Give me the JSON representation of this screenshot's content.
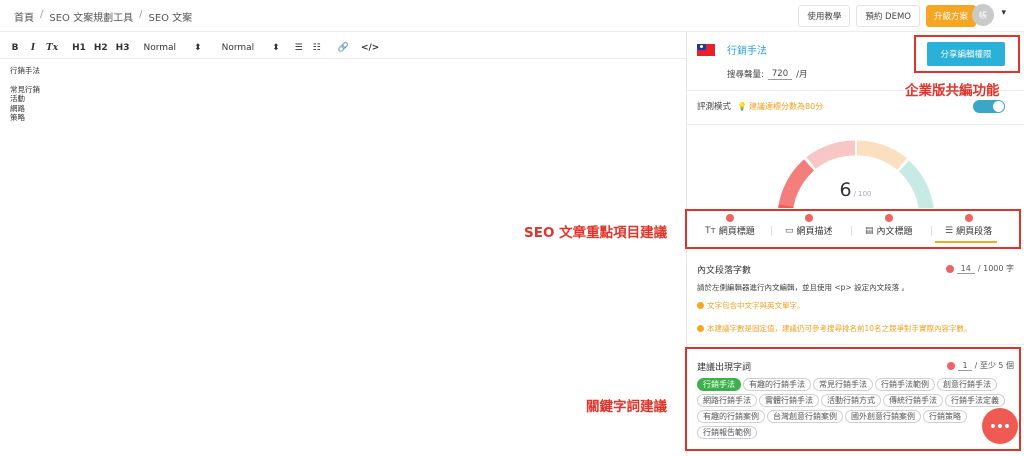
{
  "breadcrumb": [
    "首頁",
    "SEO 文案規劃工具",
    "SEO 文案"
  ],
  "breadcrumb_sep": "/",
  "top_actions": {
    "tutorial": "使用教學",
    "demo": "預約 DEMO",
    "upgrade": "升級方案",
    "avatar_initial": "帳"
  },
  "toolbar": {
    "bold": "B",
    "italic": "I",
    "clear": "Tx",
    "h1": "H1",
    "h2": "H2",
    "h3": "H3",
    "format1": "Normal",
    "format2": "Normal"
  },
  "editor": {
    "line1": "行銷手法",
    "lines": [
      "常見行銷",
      "活動",
      "網路",
      "策略"
    ]
  },
  "panel": {
    "keyword": "行銷手法",
    "volume_label": "搜尋聲量:",
    "volume_value": "720",
    "volume_unit": "/月",
    "share_button": "分享編輯權限",
    "mode_label": "評測模式",
    "mode_hint": "建議達標分數為80分",
    "score": "6",
    "score_max": "/ 100",
    "score_fraction": 0.06,
    "tabs": [
      {
        "label": "網頁標題",
        "icon": "text-icon"
      },
      {
        "label": "網頁描述",
        "icon": "id-card-icon"
      },
      {
        "label": "內文標題",
        "icon": "heading-icon"
      },
      {
        "label": "網頁段落",
        "icon": "paragraph-icon"
      }
    ],
    "active_tab": "網頁段落",
    "section1": {
      "title": "內文段落字數",
      "count": "14",
      "count_suffix": "/ 1000 字",
      "desc": "請於左側編輯器進行內文編輯，並且使用 <p> 設定內文段落 。",
      "note1": "文字包含中文字與英文單字。",
      "note2": "本建議字數是固定值，建議仍可參考搜尋排名前10名之競爭對手實際內容字數。"
    },
    "section2": {
      "title": "建議出現字詞",
      "count": "1",
      "count_suffix": "/ 至少 5 個",
      "tags": [
        "行銷手法",
        "有趣的行銷手法",
        "常見行銷手法",
        "行銷手法範例",
        "創意行銷手法",
        "網路行銷手法",
        "實體行銷手法",
        "活動行銷方式",
        "傳統行銷手法",
        "行銷手法定義",
        "有趣的行銷案例",
        "台灣創意行銷案例",
        "國外創意行銷案例",
        "行銷策略",
        "行銷報告範例"
      ]
    }
  },
  "annotations": {
    "share": "企業版共編功能",
    "seo": "SEO 文章重點項目建議",
    "keywords": "關鍵字詞建議"
  },
  "colors": {
    "accent": "#2bb0d8",
    "upgrade": "#f5a623",
    "annotation": "#e0342b",
    "tag_active": "#3cb04a",
    "alert": "#ef6461"
  }
}
